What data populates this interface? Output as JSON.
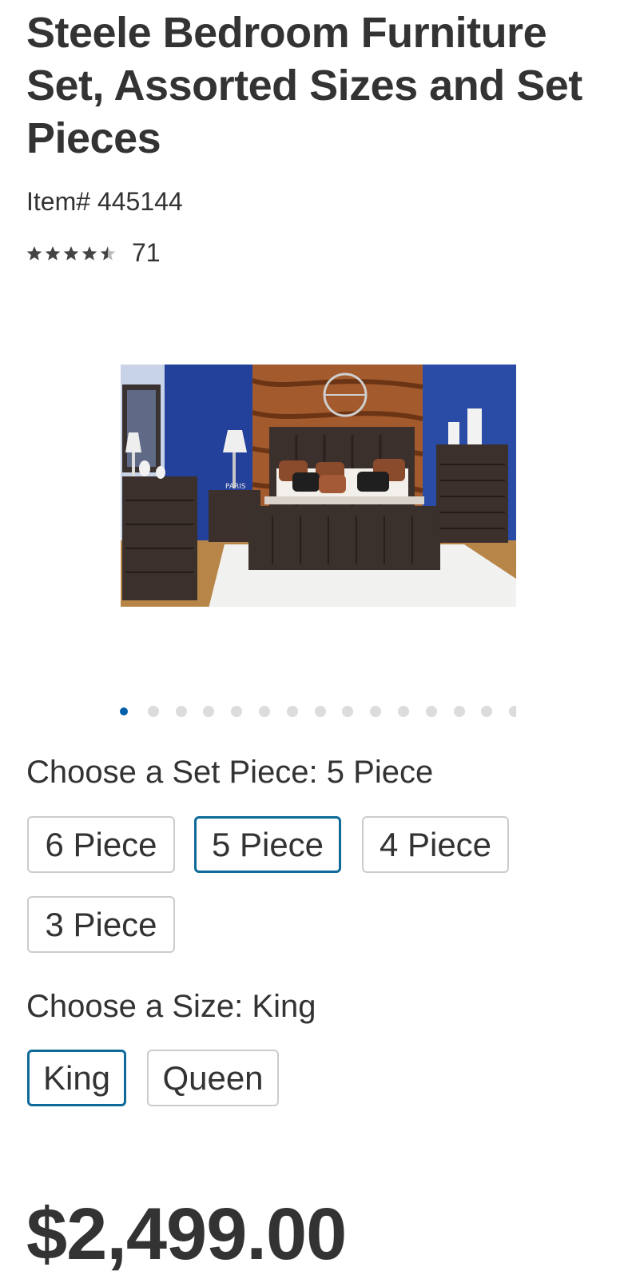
{
  "product": {
    "title": "Steele Bedroom Furniture Set, Assorted Sizes and Set Pieces",
    "item_number": "Item# 445144",
    "rating": 4.5,
    "rating_count": "71",
    "price": "$2,499.00",
    "image_sign_text": "PARIS"
  },
  "carousel": {
    "dot_count": 15,
    "active_index": 0
  },
  "set_piece": {
    "label": "Choose a Set Piece: 5 Piece",
    "options": [
      "6 Piece",
      "5 Piece",
      "4 Piece",
      "3 Piece"
    ],
    "selected": "5 Piece"
  },
  "size": {
    "label": "Choose a Size: King",
    "options": [
      "King",
      "Queen"
    ],
    "selected": "King"
  },
  "colors": {
    "text": "#333333",
    "accent": "#0e6a99",
    "dot_active": "#0060a9",
    "dot_inactive": "#dcdcdc",
    "border": "#cccccc"
  }
}
